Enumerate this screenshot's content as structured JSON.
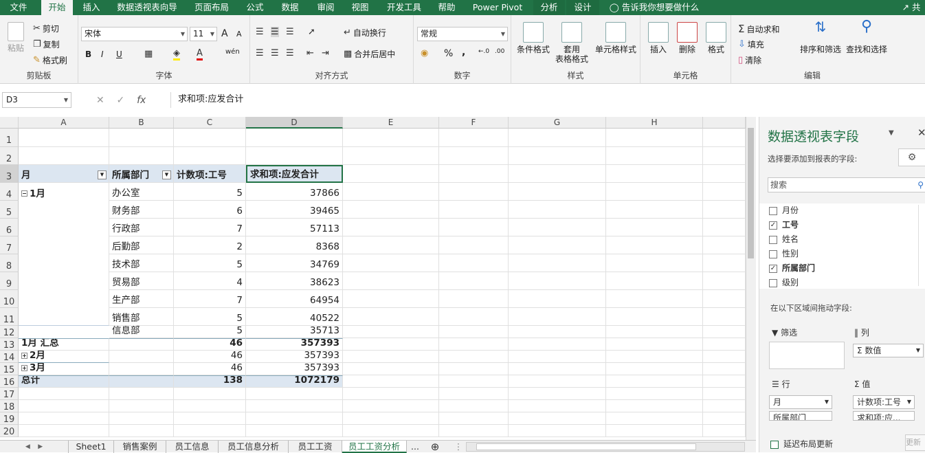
{
  "ribbon_tabs": [
    "文件",
    "开始",
    "插入",
    "数据透视表向导",
    "页面布局",
    "公式",
    "数据",
    "审阅",
    "视图",
    "开发工具",
    "帮助",
    "Power Pivot",
    "分析",
    "设计"
  ],
  "tell_me": "告诉我你想要做什么",
  "share": "共",
  "clipboard": {
    "paste": "粘贴",
    "cut": "剪切",
    "copy": "复制",
    "format_painter": "格式刷",
    "label": "剪贴板"
  },
  "font": {
    "name": "宋体",
    "size": "11",
    "bold": "B",
    "italic": "I",
    "underline": "U",
    "label": "字体",
    "grow": "A",
    "shrink": "A",
    "color_a": "A",
    "wen": "wén"
  },
  "alignment": {
    "wrap": "自动换行",
    "merge": "合并后居中",
    "label": "对齐方式"
  },
  "number": {
    "format": "常规",
    "label": "数字",
    "pct": "%",
    "comma": ","
  },
  "styles": {
    "conditional": "条件格式",
    "table_l1": "套用",
    "table_l2": "表格格式",
    "cell_styles": "单元格样式",
    "label": "样式"
  },
  "cells": {
    "insert": "插入",
    "delete": "删除",
    "format": "格式",
    "label": "单元格"
  },
  "editing": {
    "autosum": "自动求和",
    "fill": "填充",
    "clear": "清除",
    "sort": "排序和筛选",
    "find": "查找和选择",
    "label": "编辑"
  },
  "namebox": "D3",
  "formula": "求和项:应发合计",
  "columns": [
    "A",
    "B",
    "C",
    "D",
    "E",
    "F",
    "G",
    "H"
  ],
  "rows": [
    "1",
    "2",
    "3",
    "4",
    "5",
    "6",
    "7",
    "8",
    "9",
    "10",
    "11",
    "12",
    "13",
    "14",
    "15",
    "16",
    "17",
    "18",
    "19",
    "20"
  ],
  "pivot": {
    "headers": [
      "月",
      "所属部门",
      "计数项:工号",
      "求和项:应发合计"
    ],
    "month1": "1月",
    "depts": [
      {
        "name": "办公室",
        "count": "5",
        "sum": "37866"
      },
      {
        "name": "财务部",
        "count": "6",
        "sum": "39465"
      },
      {
        "name": "行政部",
        "count": "7",
        "sum": "57113"
      },
      {
        "name": "后勤部",
        "count": "2",
        "sum": "8368"
      },
      {
        "name": "技术部",
        "count": "5",
        "sum": "34769"
      },
      {
        "name": "贸易部",
        "count": "4",
        "sum": "38623"
      },
      {
        "name": "生产部",
        "count": "7",
        "sum": "64954"
      },
      {
        "name": "销售部",
        "count": "5",
        "sum": "40522"
      },
      {
        "name": "信息部",
        "count": "5",
        "sum": "35713"
      }
    ],
    "subtotal": {
      "label": "1月 汇总",
      "count": "46",
      "sum": "357393"
    },
    "month2": {
      "label": "2月",
      "count": "46",
      "sum": "357393"
    },
    "month3": {
      "label": "3月",
      "count": "46",
      "sum": "357393"
    },
    "total": {
      "label": "总计",
      "count": "138",
      "sum": "1072179"
    }
  },
  "sheets": [
    "Sheet1",
    "销售案例",
    "员工信息",
    "员工信息分析",
    "员工工资",
    "员工工资分析",
    "..."
  ],
  "field_pane": {
    "title": "数据透视表字段",
    "choose": "选择要添加到报表的字段:",
    "search": "搜索",
    "fields": [
      {
        "name": "月份",
        "checked": false
      },
      {
        "name": "工号",
        "checked": true
      },
      {
        "name": "姓名",
        "checked": false
      },
      {
        "name": "性别",
        "checked": false
      },
      {
        "name": "所属部门",
        "checked": true
      },
      {
        "name": "级别",
        "checked": false
      }
    ],
    "drag_hint": "在以下区域间拖动字段:",
    "filter": "筛选",
    "columns": "列",
    "col_value": "Σ 数值",
    "rows": "行",
    "values": "值",
    "row_items": [
      "月",
      "所属部门"
    ],
    "val_items": [
      "计数项:工号",
      "求和项:应..."
    ],
    "defer": "延迟布局更新",
    "update": "更新"
  }
}
